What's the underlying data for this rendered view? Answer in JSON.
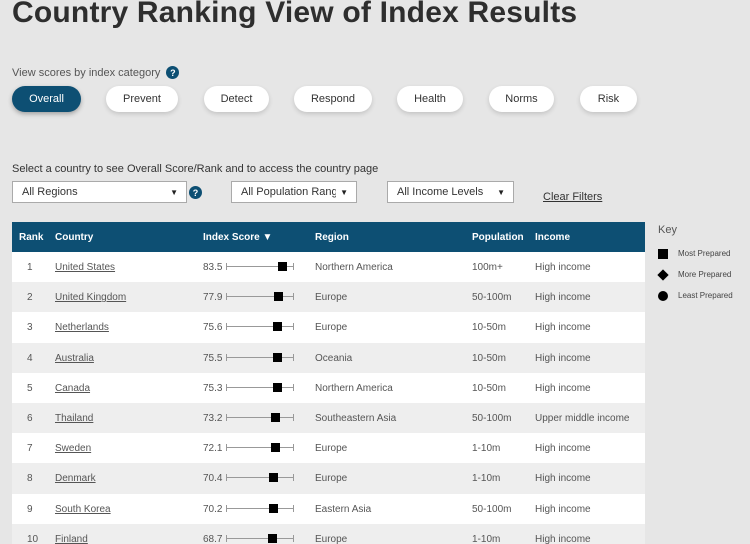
{
  "page": {
    "title": "Country Ranking View of Index Results"
  },
  "category_filter": {
    "label": "View scores by index category",
    "help_icon": "question-mark-icon",
    "tabs": [
      {
        "label": "Overall",
        "active": true
      },
      {
        "label": "Prevent",
        "active": false
      },
      {
        "label": "Detect",
        "active": false
      },
      {
        "label": "Respond",
        "active": false
      },
      {
        "label": "Health",
        "active": false
      },
      {
        "label": "Norms",
        "active": false
      },
      {
        "label": "Risk",
        "active": false
      }
    ]
  },
  "country_filter": {
    "label": "Select a country to see Overall Score/Rank and to access the country page",
    "regions": "All Regions",
    "population": "All Population Ranges",
    "income": "All Income Levels",
    "clear": "Clear Filters"
  },
  "table": {
    "headers": {
      "rank": "Rank",
      "country": "Country",
      "score": "Index Score ▼",
      "region": "Region",
      "population": "Population",
      "income": "Income"
    },
    "rows": [
      {
        "rank": "1",
        "country": "United States",
        "score": "83.5",
        "region": "Northern America",
        "population": "100m+",
        "income": "High income"
      },
      {
        "rank": "2",
        "country": "United Kingdom",
        "score": "77.9",
        "region": "Europe",
        "population": "50-100m",
        "income": "High income"
      },
      {
        "rank": "3",
        "country": "Netherlands",
        "score": "75.6",
        "region": "Europe",
        "population": "10-50m",
        "income": "High income"
      },
      {
        "rank": "4",
        "country": "Australia",
        "score": "75.5",
        "region": "Oceania",
        "population": "10-50m",
        "income": "High income"
      },
      {
        "rank": "5",
        "country": "Canada",
        "score": "75.3",
        "region": "Northern America",
        "population": "10-50m",
        "income": "High income"
      },
      {
        "rank": "6",
        "country": "Thailand",
        "score": "73.2",
        "region": "Southeastern Asia",
        "population": "50-100m",
        "income": "Upper middle income"
      },
      {
        "rank": "7",
        "country": "Sweden",
        "score": "72.1",
        "region": "Europe",
        "population": "1-10m",
        "income": "High income"
      },
      {
        "rank": "8",
        "country": "Denmark",
        "score": "70.4",
        "region": "Europe",
        "population": "1-10m",
        "income": "High income"
      },
      {
        "rank": "9",
        "country": "South Korea",
        "score": "70.2",
        "region": "Eastern Asia",
        "population": "50-100m",
        "income": "High income"
      },
      {
        "rank": "10",
        "country": "Finland",
        "score": "68.7",
        "region": "Europe",
        "population": "1-10m",
        "income": "High income"
      }
    ]
  },
  "key": {
    "title": "Key",
    "items": [
      {
        "label": "Most Prepared",
        "shape": "square"
      },
      {
        "label": "More Prepared",
        "shape": "diamond"
      },
      {
        "label": "Least Prepared",
        "shape": "circle"
      }
    ]
  },
  "colors": {
    "accent": "#0d4f73",
    "background": "#e6e6e6"
  }
}
